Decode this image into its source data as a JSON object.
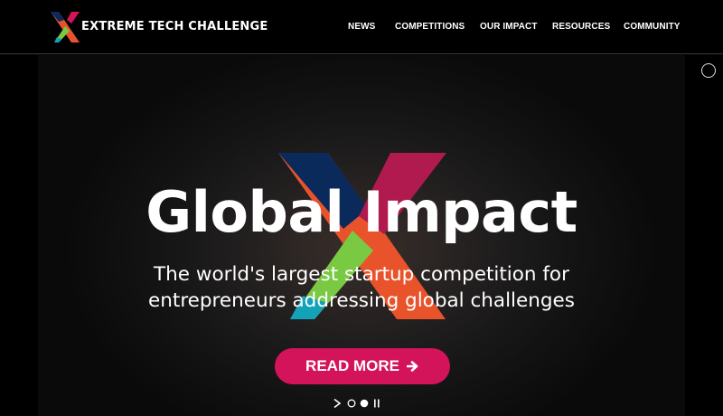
{
  "header": {
    "brand": "EXTREME TECH CHALLENGE",
    "logo_icon": "x-logo-icon",
    "nav": [
      "NEWS",
      "COMPETITIONS",
      "OUR IMPACT",
      "RESOURCES",
      "COMMUNITY"
    ]
  },
  "hero": {
    "title": "Global Impact",
    "subtitle": "The world's largest startup competition for entrepreneurs addressing global challenges",
    "cta_label": "READ MORE",
    "cta_icon": "arrow-right-icon",
    "background_icon": "x-logo-icon"
  },
  "slider": {
    "controls": [
      "next-icon",
      "slide-dot-icon",
      "slide-dot-active-icon",
      "pause-icon"
    ],
    "slide_count": 2,
    "active_slide": 2
  },
  "colors": {
    "accent": "#d4145a",
    "x_navy": "#0a2a5c",
    "x_orange": "#e8532b",
    "x_crimson": "#b01a4f",
    "x_green": "#7ac943",
    "x_teal": "#13a2b8"
  }
}
